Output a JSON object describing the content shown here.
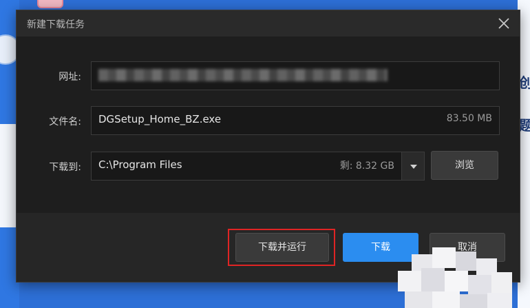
{
  "dialog": {
    "title": "新建下载任务",
    "url_label": "网址:",
    "filename_label": "文件名:",
    "filename_value": "DGSetup_Home_BZ.exe",
    "file_size": "83.50 MB",
    "saveto_label": "下载到:",
    "saveto_value": "C:\\Program Files",
    "free_space": "剩: 8.32 GB",
    "browse_label": "浏览",
    "download_run_label": "下载并运行",
    "download_label": "下载",
    "cancel_label": "取消"
  },
  "background": {
    "right_chars": [
      "创",
      "题"
    ]
  },
  "colors": {
    "accent": "#2b8df0",
    "highlight_box": "#e02424",
    "dialog_bg": "#262626"
  }
}
